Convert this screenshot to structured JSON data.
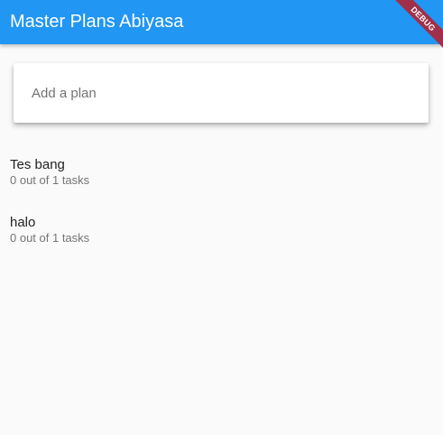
{
  "appbar": {
    "title": "Master Plans Abiyasa",
    "color": "#2196f3"
  },
  "debug_banner": {
    "label": "DEBUG"
  },
  "input": {
    "placeholder": "Add a plan",
    "value": ""
  },
  "plans": [
    {
      "title": "Tes bang",
      "subtitle": "0 out of 1 tasks"
    },
    {
      "title": "halo",
      "subtitle": "0 out of 1 tasks"
    }
  ]
}
